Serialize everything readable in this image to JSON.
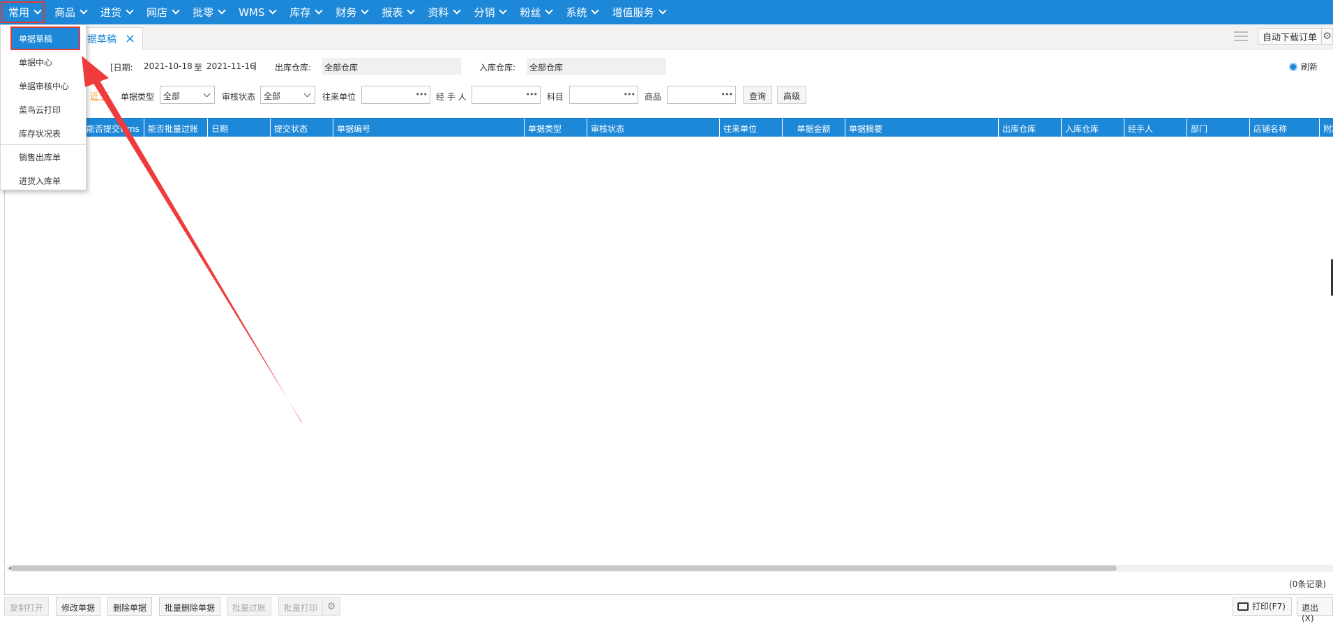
{
  "nav": {
    "items": [
      "常用",
      "商品",
      "进货",
      "网店",
      "批零",
      "WMS",
      "库存",
      "财务",
      "报表",
      "资料",
      "分销",
      "粉丝",
      "系统",
      "增值服务"
    ]
  },
  "dropdown": {
    "items": [
      "单据草稿",
      "单据中心",
      "单据审核中心",
      "菜鸟云打印",
      "库存状况表",
      "销售出库单",
      "进货入库单"
    ]
  },
  "tab": {
    "label": "据草稿",
    "close_icon": "×"
  },
  "toolbar_right": {
    "auto_download": "自动下载订单"
  },
  "filters": {
    "date_prefix": "[日期:",
    "date_from": "2021-10-18",
    "date_to_sep": "至",
    "date_to": "2021-11-16",
    "date_suffix": "]",
    "out_wh_label": "出库仓库:",
    "out_wh_value": "全部仓库",
    "in_wh_label": "入库仓库:",
    "in_wh_value": "全部仓库",
    "refresh": "刷新",
    "recent": "近 天",
    "doc_type_label": "单据类型",
    "doc_type_value": "全部",
    "audit_label": "审核状态",
    "audit_value": "全部",
    "partner_label": "往来单位",
    "handler_label": "经 手 人",
    "subject_label": "科目",
    "product_label": "商品",
    "query": "查询",
    "advanced": "高级"
  },
  "grid": {
    "columns": [
      "能否提交wms",
      "能否批量过账",
      "日期",
      "提交状态",
      "单据编号",
      "单据类型",
      "审核状态",
      "往来单位",
      "单据金额",
      "单据摘要",
      "出库仓库",
      "入库仓库",
      "经手人",
      "部门",
      "店铺名称",
      "附加"
    ],
    "records_text": "(0条记录)"
  },
  "bottom": {
    "copy_open": "复制打开",
    "edit": "修改单据",
    "delete": "删除单据",
    "batch_delete": "批量删除单据",
    "batch_post": "批量过账",
    "batch_print": "批量打印",
    "print": "打印(F7)",
    "exit": "退出(X)"
  },
  "colors": {
    "accent": "#1e88d8",
    "highlight_box": "#e53935",
    "recent_link": "#f59b2c"
  }
}
